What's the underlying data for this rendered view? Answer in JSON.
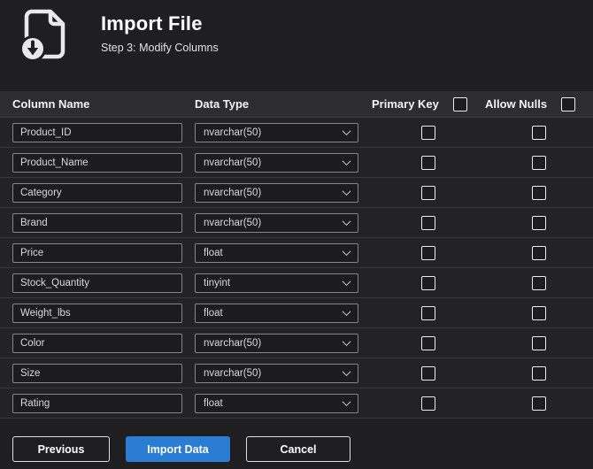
{
  "colors": {
    "accent": "#2b7cd3"
  },
  "header": {
    "title": "Import File",
    "subtitle": "Step 3: Modify Columns"
  },
  "table": {
    "headers": {
      "column_name": "Column Name",
      "data_type": "Data Type",
      "primary_key": "Primary Key",
      "allow_nulls": "Allow Nulls"
    },
    "header_checkboxes": {
      "primary_key_all": false,
      "allow_nulls_all": false
    },
    "rows": [
      {
        "name": "Product_ID",
        "type": "nvarchar(50)",
        "primary_key": false,
        "allow_nulls": false
      },
      {
        "name": "Product_Name",
        "type": "nvarchar(50)",
        "primary_key": false,
        "allow_nulls": false
      },
      {
        "name": "Category",
        "type": "nvarchar(50)",
        "primary_key": false,
        "allow_nulls": false
      },
      {
        "name": "Brand",
        "type": "nvarchar(50)",
        "primary_key": false,
        "allow_nulls": false
      },
      {
        "name": "Price",
        "type": "float",
        "primary_key": false,
        "allow_nulls": false
      },
      {
        "name": "Stock_Quantity",
        "type": "tinyint",
        "primary_key": false,
        "allow_nulls": false
      },
      {
        "name": "Weight_lbs",
        "type": "float",
        "primary_key": false,
        "allow_nulls": false
      },
      {
        "name": "Color",
        "type": "nvarchar(50)",
        "primary_key": false,
        "allow_nulls": false
      },
      {
        "name": "Size",
        "type": "nvarchar(50)",
        "primary_key": false,
        "allow_nulls": false
      },
      {
        "name": "Rating",
        "type": "float",
        "primary_key": false,
        "allow_nulls": false
      }
    ]
  },
  "footer": {
    "previous_label": "Previous",
    "import_label": "Import Data",
    "cancel_label": "Cancel"
  }
}
